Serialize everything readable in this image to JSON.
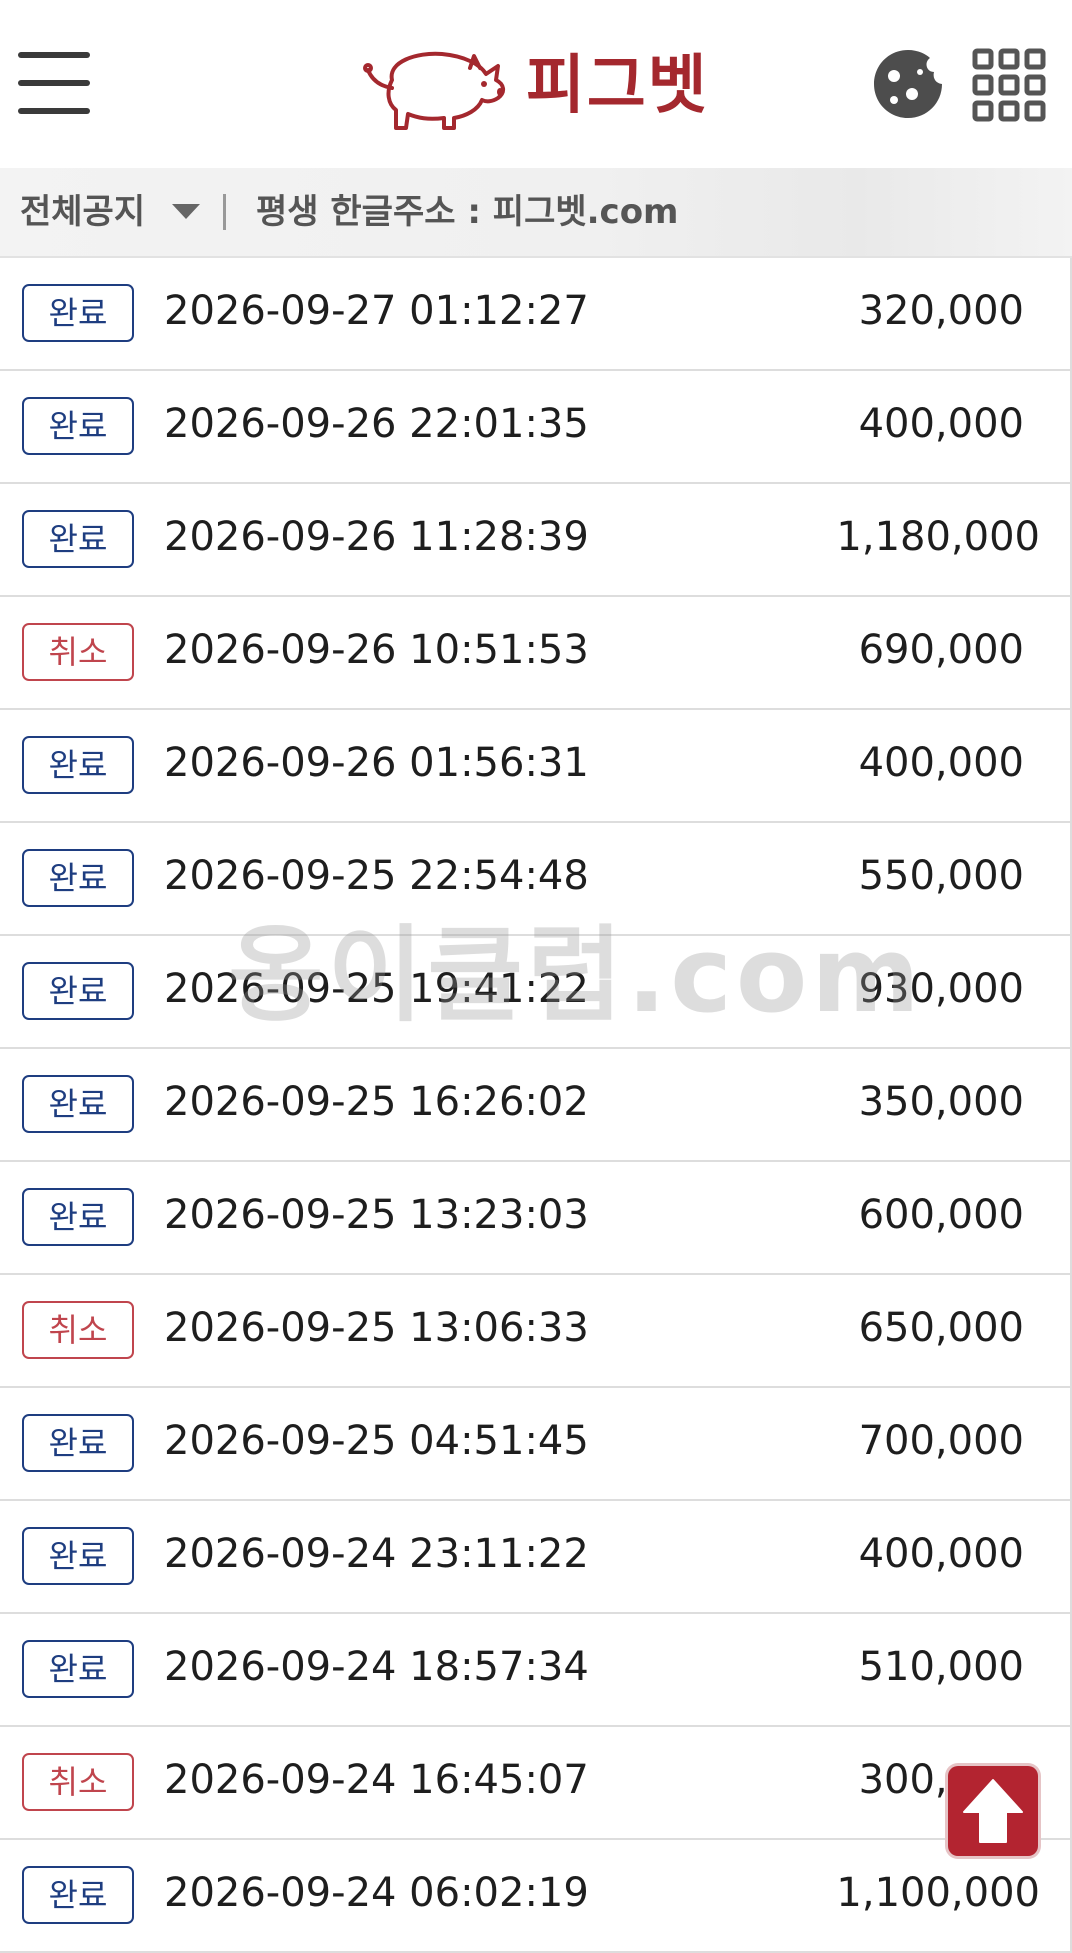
{
  "header": {
    "brand_text": "피그벳",
    "brand_color": "#a4282e",
    "icons": [
      "hamburger-menu-icon",
      "pig-logo-icon",
      "cookie-icon",
      "grid-apps-icon"
    ]
  },
  "notice": {
    "category": "전체공지",
    "text": "평생 한글주소 : 피그벳.com"
  },
  "colors": {
    "complete_badge": "#1e3d80",
    "cancel_badge": "#c0454d",
    "scroll_top_button": "#b32430"
  },
  "rows": [
    {
      "status": "완료",
      "status_type": "complete",
      "datetime": "2026-09-27 01:12:27",
      "amount": "320,000"
    },
    {
      "status": "완료",
      "status_type": "complete",
      "datetime": "2026-09-26 22:01:35",
      "amount": "400,000"
    },
    {
      "status": "완료",
      "status_type": "complete",
      "datetime": "2026-09-26 11:28:39",
      "amount": "1,180,000"
    },
    {
      "status": "취소",
      "status_type": "cancel",
      "datetime": "2026-09-26 10:51:53",
      "amount": "690,000"
    },
    {
      "status": "완료",
      "status_type": "complete",
      "datetime": "2026-09-26 01:56:31",
      "amount": "400,000"
    },
    {
      "status": "완료",
      "status_type": "complete",
      "datetime": "2026-09-25 22:54:48",
      "amount": "550,000"
    },
    {
      "status": "완료",
      "status_type": "complete",
      "datetime": "2026-09-25 19:41:22",
      "amount": "930,000"
    },
    {
      "status": "완료",
      "status_type": "complete",
      "datetime": "2026-09-25 16:26:02",
      "amount": "350,000"
    },
    {
      "status": "완료",
      "status_type": "complete",
      "datetime": "2026-09-25 13:23:03",
      "amount": "600,000"
    },
    {
      "status": "취소",
      "status_type": "cancel",
      "datetime": "2026-09-25 13:06:33",
      "amount": "650,000"
    },
    {
      "status": "완료",
      "status_type": "complete",
      "datetime": "2026-09-25 04:51:45",
      "amount": "700,000"
    },
    {
      "status": "완료",
      "status_type": "complete",
      "datetime": "2026-09-24 23:11:22",
      "amount": "400,000"
    },
    {
      "status": "완료",
      "status_type": "complete",
      "datetime": "2026-09-24 18:57:34",
      "amount": "510,000"
    },
    {
      "status": "취소",
      "status_type": "cancel",
      "datetime": "2026-09-24 16:45:07",
      "amount": "300,000"
    },
    {
      "status": "완료",
      "status_type": "complete",
      "datetime": "2026-09-24 06:02:19",
      "amount": "1,100,000"
    }
  ],
  "watermark": "옹이클럽.com"
}
